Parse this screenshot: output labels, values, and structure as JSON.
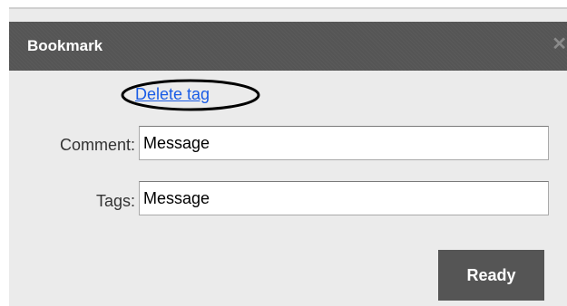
{
  "dialog": {
    "title": "Bookmark",
    "close_glyph": "✕",
    "close_icon": "close-icon"
  },
  "delete_tag": {
    "label": "Delete tag"
  },
  "form": {
    "comment": {
      "label": "Comment:",
      "value": "Message"
    },
    "tags": {
      "label": "Tags:",
      "value": "Message"
    }
  },
  "actions": {
    "ready_label": "Ready"
  },
  "colors": {
    "titlebar": "#555555",
    "panel": "#ebebeb",
    "link": "#1a5ce6",
    "button": "#555555"
  }
}
